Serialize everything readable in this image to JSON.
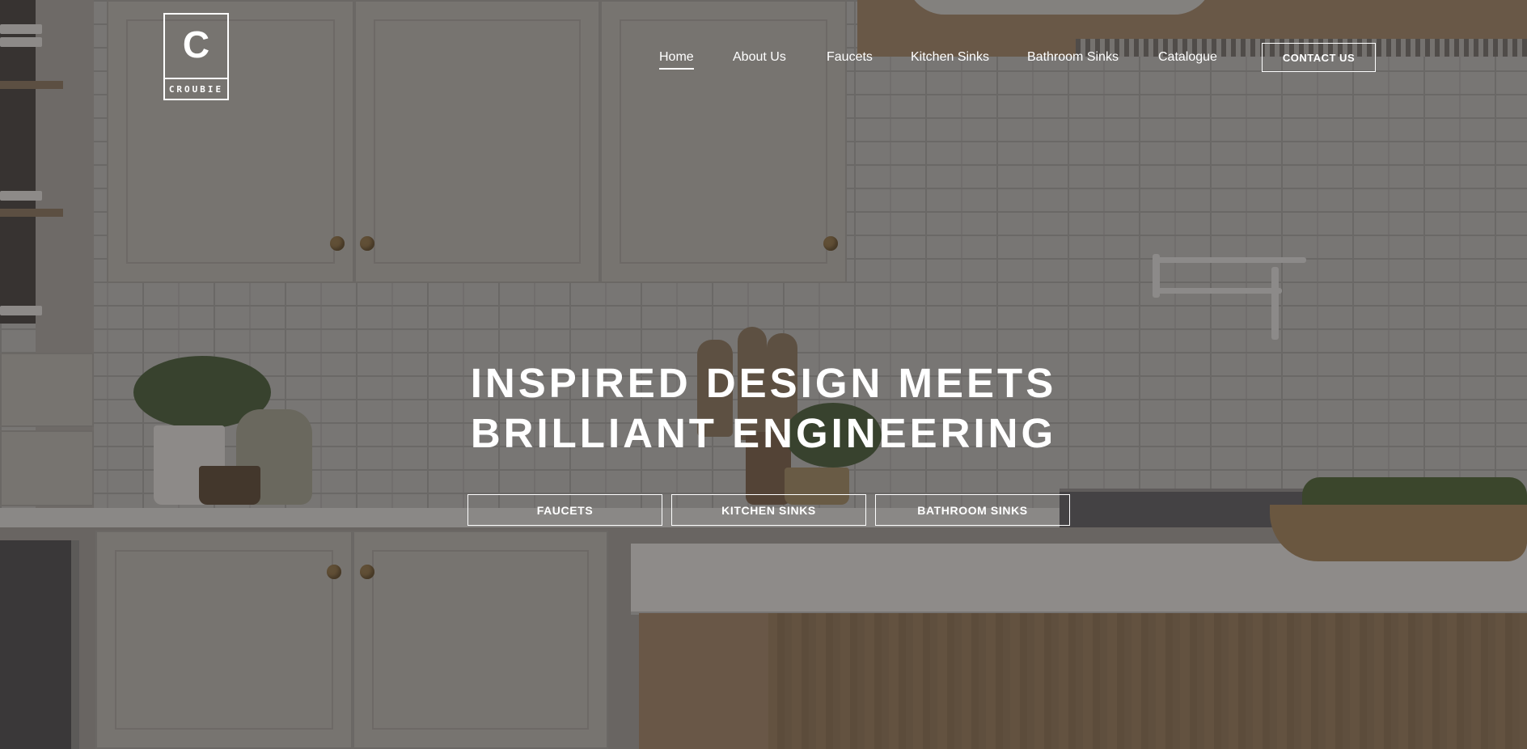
{
  "brand": {
    "logo_letter": "C",
    "logo_word": "CROUBIE"
  },
  "nav": {
    "items": [
      {
        "label": "Home",
        "active": true
      },
      {
        "label": "About Us"
      },
      {
        "label": "Faucets"
      },
      {
        "label": "Kitchen Sinks"
      },
      {
        "label": "Bathroom Sinks"
      },
      {
        "label": "Catalogue"
      }
    ],
    "contact_label": "CONTACT US"
  },
  "hero": {
    "headline_line1": "INSPIRED DESIGN MEETS",
    "headline_line2": "BRILLIANT ENGINEERING",
    "buttons": [
      {
        "label": "FAUCETS"
      },
      {
        "label": "KITCHEN SINKS"
      },
      {
        "label": "BATHROOM SINKS"
      }
    ]
  },
  "colors": {
    "text": "#ffffff",
    "overlay": "#2d2a28"
  }
}
